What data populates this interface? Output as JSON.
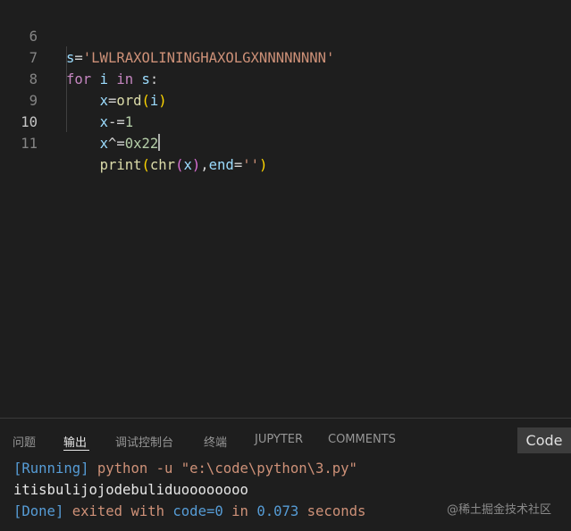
{
  "editor": {
    "lines": [
      {
        "no": "6",
        "code": "s='LWLRAXOLININGHAXOLGXNNNNNNNN'"
      },
      {
        "no": "7",
        "code": "for i in s:"
      },
      {
        "no": "8",
        "code": "    x=ord(i)"
      },
      {
        "no": "9",
        "code": "    x-=1"
      },
      {
        "no": "10",
        "code": "    x^=0x22",
        "active": true
      },
      {
        "no": "11",
        "code": "    print(chr(x),end='')"
      }
    ]
  },
  "panel": {
    "tabs": [
      {
        "label": "问题"
      },
      {
        "label": "输出",
        "active": true
      },
      {
        "label": "调试控制台"
      },
      {
        "label": "终端"
      },
      {
        "label": "JUPYTER"
      },
      {
        "label": "COMMENTS"
      }
    ],
    "language_badge": "Code",
    "output": {
      "run_tag": "[Running]",
      "run_cmd": " python -u \"e:\\code\\python\\3.py\"",
      "result": "itisbulijojodebuliduoooooooo",
      "done_tag": "[Done]",
      "done_text": " exited with ",
      "done_code": "code=0",
      "done_in": " in ",
      "done_time": "0.073",
      "done_unit": " seconds"
    },
    "watermark": "@稀土掘金技术社区"
  },
  "colors": {
    "background": "#1e1e1e",
    "keyword": "#c586c0",
    "string": "#ce9178",
    "variable": "#9cdcfe",
    "function": "#dcdcaa",
    "number": "#b5cea8",
    "output_tag": "#569cd6"
  }
}
